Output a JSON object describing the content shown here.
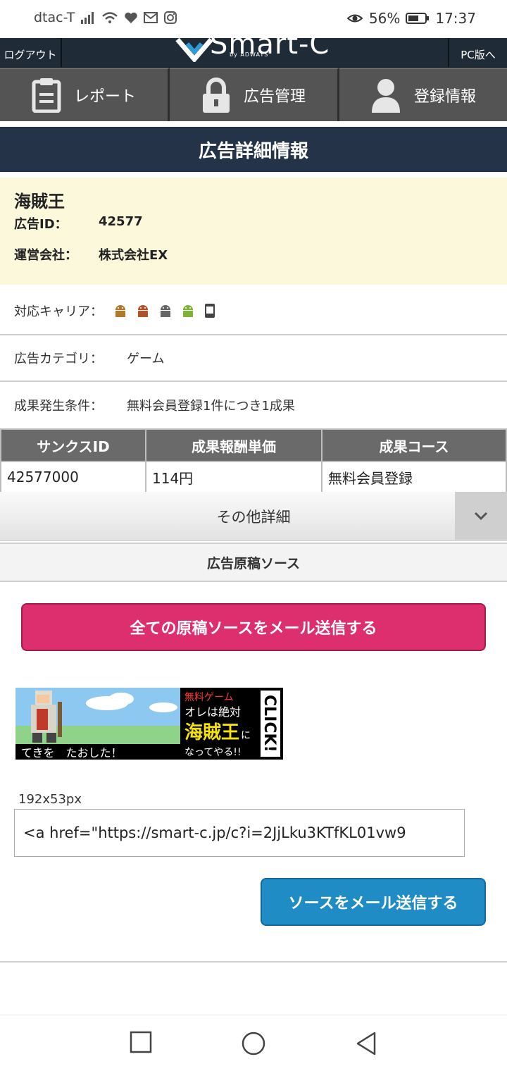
{
  "status_bar": {
    "carrier": "dtac-T",
    "battery": "56%",
    "time": "17:37"
  },
  "header": {
    "logout": "ログアウト",
    "brand": "Smart-C",
    "by_line": "by ADWAYS",
    "pc_version": "PC版へ"
  },
  "tabs": [
    {
      "label": "レポート",
      "icon": "clipboard-icon"
    },
    {
      "label": "広告管理",
      "icon": "lock-icon"
    },
    {
      "label": "登録情報",
      "icon": "user-icon"
    }
  ],
  "page_title": "広告詳細情報",
  "ad": {
    "name": "海賊王",
    "id_label": "広告ID：",
    "id": "42577",
    "company_label": "運営会社：",
    "company": "株式会社EX"
  },
  "details": {
    "carrier_label": "対応キャリア：",
    "carrier_icons": [
      "android-icon",
      "android-icon",
      "android-icon",
      "android-icon",
      "smartphone-icon"
    ],
    "category_label": "広告カテゴリ：",
    "category": "ゲーム",
    "condition_label": "成果発生条件：",
    "condition": "無料会員登録1件につき1成果"
  },
  "table": {
    "headers": [
      "サンクスID",
      "成果報酬単価",
      "成果コース"
    ],
    "rows": [
      [
        "42577000",
        "114円",
        "無料会員登録"
      ]
    ]
  },
  "other_details": "その他詳細",
  "source_header": "広告原稿ソース",
  "mail_all_button": "全ての原稿ソースをメール送信する",
  "banner": {
    "caption": "てきを　たおした！",
    "free_game": "無料ゲーム",
    "line1": "オレは絶対",
    "line2": "海賊王",
    "line2b": "に",
    "line3": "なってやる!!",
    "click": "CLICK!",
    "size": "192x53px"
  },
  "code_value": "<a href=\"https://smart-c.jp/c?i=2JjLku3KTfKL01vw9",
  "mail_one_button": "ソースをメール送信する",
  "colors": {
    "header_bg": "#1f2b36",
    "tab_bg": "#545454",
    "title_bg": "#243347",
    "info_bg": "#fcf8dc",
    "pink_button": "#dd2f6e",
    "blue_button": "#1f8cc6"
  }
}
